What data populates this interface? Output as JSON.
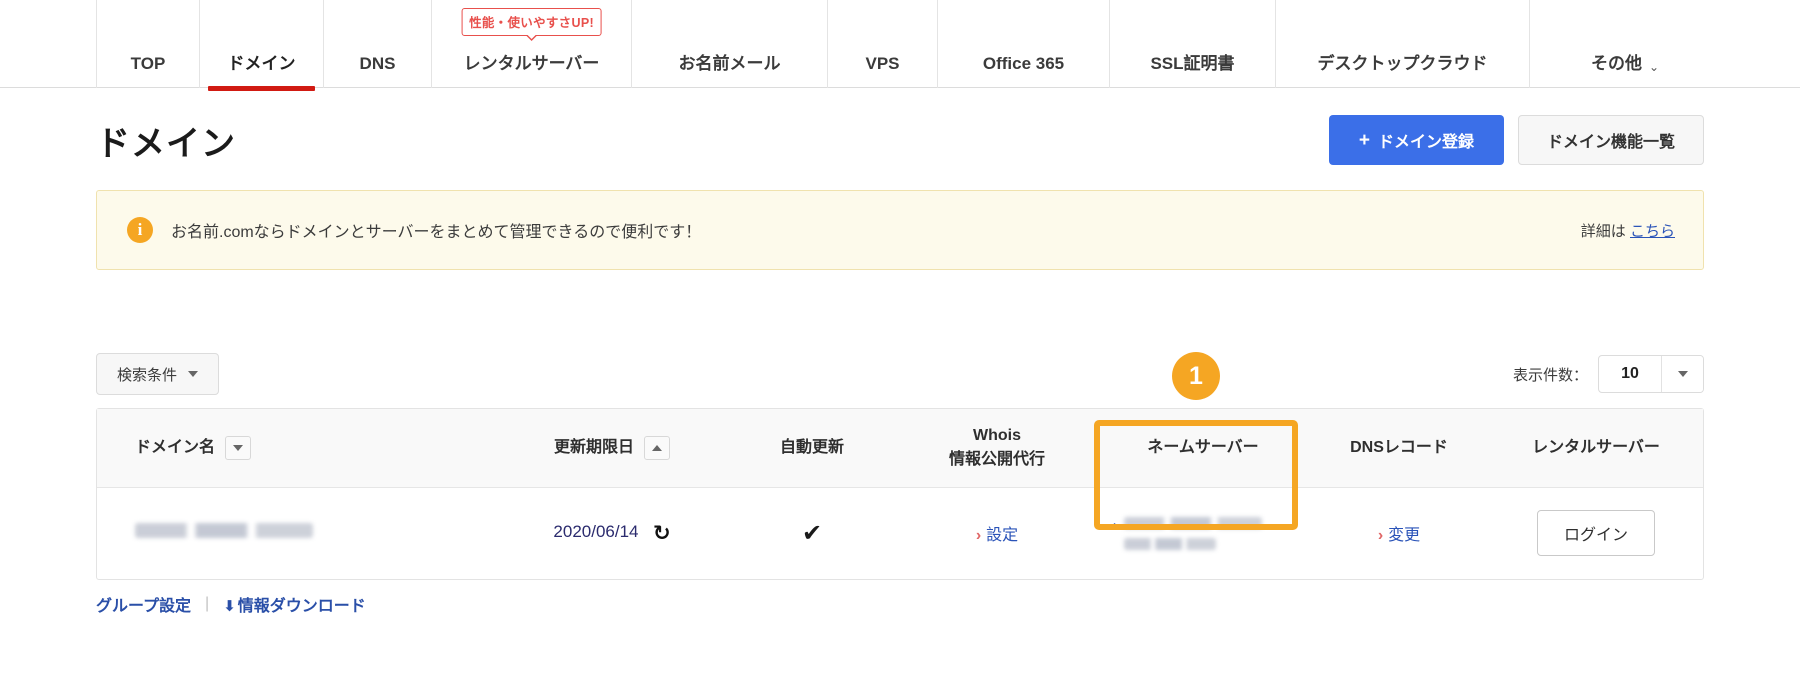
{
  "global_nav": {
    "items": [
      {
        "label": "TOP",
        "active": false,
        "width_class": "w-top"
      },
      {
        "label": "ドメイン",
        "active": true,
        "width_class": "w-dom"
      },
      {
        "label": "DNS",
        "active": false,
        "width_class": "w-dns"
      },
      {
        "label": "レンタルサーバー",
        "active": false,
        "width_class": "w-rs",
        "badge": "性能・使いやすさUP!"
      },
      {
        "label": "お名前メール",
        "active": false,
        "width_class": "w-mail"
      },
      {
        "label": "VPS",
        "active": false,
        "width_class": "w-vps"
      },
      {
        "label": "Office 365",
        "active": false,
        "width_class": "w-o365"
      },
      {
        "label": "SSL証明書",
        "active": false,
        "width_class": "w-ssl"
      },
      {
        "label": "デスクトップクラウド",
        "active": false,
        "width_class": "w-dtc"
      },
      {
        "label": "その他",
        "active": false,
        "width_class": "w-etc",
        "chevron": "⌄"
      }
    ]
  },
  "header": {
    "title": "ドメイン",
    "register_button": "ドメイン登録",
    "register_button_plus": "+",
    "features_button": "ドメイン機能一覧"
  },
  "notice": {
    "icon": "info-icon",
    "icon_glyph": "i",
    "text": "お名前.comならドメインとサーバーをまとめて管理できるので便利です！",
    "detail_prefix": "詳細は",
    "detail_link": "こちら"
  },
  "controls": {
    "filter_label": "検索条件",
    "per_page_label": "表示件数：",
    "per_page_value": "10"
  },
  "table": {
    "columns": [
      {
        "label": "ドメイン名",
        "sort": "down",
        "align": "left"
      },
      {
        "label": "更新期限日",
        "sort": "up",
        "align": "center"
      },
      {
        "label": "自動更新",
        "sort": null,
        "align": "center"
      },
      {
        "label": "Whois\n情報公開代行",
        "line1": "Whois",
        "line2": "情報公開代行",
        "sort": null,
        "align": "center"
      },
      {
        "label": "ネームサーバー",
        "sort": null,
        "align": "center"
      },
      {
        "label": "DNSレコード",
        "sort": null,
        "align": "center"
      },
      {
        "label": "レンタルサーバー",
        "sort": null,
        "align": "center"
      }
    ],
    "rows": [
      {
        "domain": "",
        "domain_redacted": true,
        "expiry": "2020/06/14",
        "renew_icon": "↻",
        "auto_renew": "✔",
        "whois_link": "設定",
        "whois_arrow": "›",
        "nameserver_redacted": true,
        "dns_link": "変更",
        "dns_arrow": "›",
        "rental_button": "ログイン"
      }
    ]
  },
  "callout": {
    "number": "1",
    "color": "#f5a623",
    "target_column": "ネームサーバー"
  },
  "footer": {
    "group_settings": "グループ設定",
    "separator": "|",
    "download_icon": "⬇",
    "download_label": "情報ダウンロード"
  },
  "colors": {
    "accent_blue": "#3b6fe8",
    "link_blue": "#2a53b8",
    "active_red": "#d11a12",
    "badge_red": "#e8504c",
    "notice_bg": "#fdfaeb",
    "notice_border": "#f0e2ae",
    "highlight_orange": "#f5a623"
  }
}
